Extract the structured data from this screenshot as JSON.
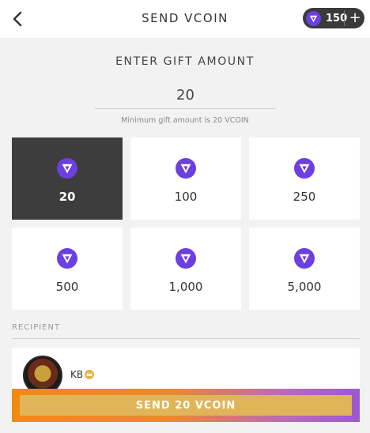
{
  "header": {
    "title": "SEND VCOIN",
    "balance": "150",
    "add_symbol": "+"
  },
  "gift": {
    "label": "ENTER GIFT AMOUNT",
    "amount_value": "20",
    "min_note": "Minimum gift amount is 20 VCOIN"
  },
  "options": [
    {
      "amount": "20",
      "selected": true
    },
    {
      "amount": "100",
      "selected": false
    },
    {
      "amount": "250",
      "selected": false
    },
    {
      "amount": "500",
      "selected": false
    },
    {
      "amount": "1,000",
      "selected": false
    },
    {
      "amount": "5,000",
      "selected": false
    }
  ],
  "recipient": {
    "label": "RECIPIENT",
    "name": "KB"
  },
  "send": {
    "label": "SEND 20 VCOIN"
  },
  "icons": {
    "back": "chevron-left-icon",
    "coin": "vcoin-icon",
    "crown": "crown-icon"
  },
  "colors": {
    "coin_purple": "#6c3fe0",
    "selected_tile": "#3d3d3d",
    "send_gradient_start": "#f28a10",
    "send_gradient_end": "#9b59d0",
    "send_button": "#e0b55a"
  }
}
